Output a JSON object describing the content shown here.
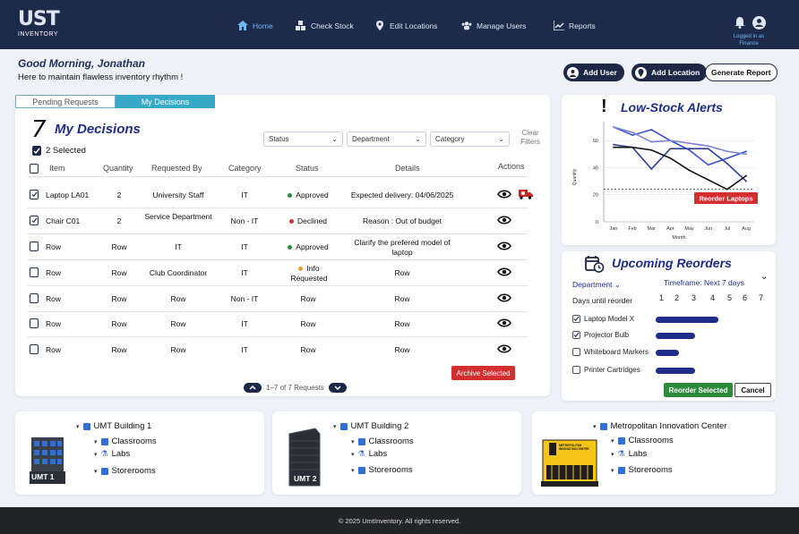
{
  "app": {
    "logo_mark": "UST",
    "logo_word": "INVENTORY"
  },
  "nav": {
    "items": [
      {
        "label": "Home",
        "icon": "home-icon",
        "active": true
      },
      {
        "label": "Check Stock",
        "icon": "boxes-icon"
      },
      {
        "label": "Edit Locations",
        "icon": "pin-icon"
      },
      {
        "label": "Manage Users",
        "icon": "users-icon"
      },
      {
        "label": "Reports",
        "icon": "chart-icon"
      }
    ],
    "logged_in_as": "Logged in as",
    "role": "Finance"
  },
  "header": {
    "greeting": "Good Morning, Jonathan",
    "subtitle": "Here to maintain flawless inventory rhythm !",
    "add_user": "Add User",
    "add_location": "Add Location",
    "generate_report": "Generate Report"
  },
  "decisions": {
    "tab_pending": "Pending Requests",
    "tab_mine": "My Decisions",
    "count": "7",
    "title": "My Decisions",
    "filters": {
      "status": "Status",
      "department": "Department",
      "category": "Category",
      "clear": "Clear Filters"
    },
    "selected_text": "2 Selected",
    "columns": [
      "Item",
      "Quantity",
      "Requested By",
      "Category",
      "Status",
      "Details",
      "Actions"
    ],
    "rows": [
      {
        "item": "Laptop LA01",
        "qty": "2",
        "by": "University Staff",
        "cat": "IT",
        "status": "Approved",
        "status_color": "#2e8b3a",
        "details": "Expected delivery: 04/06/2025",
        "checked": true,
        "truck": true
      },
      {
        "item": "Chair C01",
        "qty": "2",
        "by": "Service Department",
        "cat": "Non - IT",
        "status": "Declined",
        "status_color": "#d32f2f",
        "details": "Reason : Out of budget",
        "checked": true
      },
      {
        "item": "Row",
        "qty": "Row",
        "by": "IT",
        "cat": "IT",
        "status": "Approved",
        "status_color": "#2e8b3a",
        "details": "Clarify the prefered model of laptop"
      },
      {
        "item": "Row",
        "qty": "Row",
        "by": "Club Coordinator",
        "cat": "IT",
        "status": "Info Requested",
        "status_color": "#f0a030",
        "details": "Row"
      },
      {
        "item": "Row",
        "qty": "Row",
        "by": "Row",
        "cat": "Non - IT",
        "status": "Row",
        "details": "Row"
      },
      {
        "item": "Row",
        "qty": "Row",
        "by": "Row",
        "cat": "IT",
        "status": "Row",
        "details": "Row"
      },
      {
        "item": "Row",
        "qty": "Row",
        "by": "Row",
        "cat": "IT",
        "status": "Row",
        "details": "Row"
      }
    ],
    "archive": "Archive Selected",
    "pager": "1–7 of 7 Requests"
  },
  "low_stock": {
    "title": "Low-Stock Alerts",
    "ylabel": "Quantity",
    "xlabel": "Month",
    "reorder_label": "Reorder Laptops"
  },
  "chart_data": {
    "type": "line",
    "categories": [
      "Jan",
      "Feb",
      "Mar",
      "Apr",
      "May",
      "Jun",
      "Jul",
      "Aug"
    ],
    "ylim": [
      0,
      70
    ],
    "yticks": [
      0,
      20,
      40,
      60
    ],
    "threshold": 24,
    "series": [
      {
        "color": "#3a4fd0",
        "values": [
          70,
          64,
          68,
          60,
          53,
          42,
          47,
          52
        ]
      },
      {
        "color": "#7b86d6",
        "values": [
          70,
          66,
          59,
          60,
          58,
          56,
          52,
          50
        ]
      },
      {
        "color": "#2f3f9a",
        "values": [
          57,
          55,
          39,
          54,
          54,
          54,
          43,
          30
        ]
      },
      {
        "color": "#111111",
        "values": [
          55,
          55,
          53,
          47,
          38,
          31,
          24,
          34
        ]
      }
    ]
  },
  "upcoming": {
    "title": "Upcoming Reorders",
    "department": "Department",
    "timeframe": "Timeframe: Next 7 days",
    "days_label": "Days until reorder",
    "days": [
      "1",
      "2",
      "3",
      "4",
      "5",
      "6",
      "7"
    ],
    "items": [
      {
        "label": "Laptop Model X",
        "checked": true,
        "days": 4
      },
      {
        "label": "Projector Bulb",
        "checked": true,
        "days": 2.5
      },
      {
        "label": "Whiteboard Markers",
        "checked": false,
        "days": 1.5
      },
      {
        "label": "Printer Cartridges",
        "checked": false,
        "days": 2.5
      }
    ],
    "reorder": "Reorder Selected",
    "cancel": "Cancel"
  },
  "buildings": [
    {
      "name": "UMT Building 1",
      "badge": "UMT 1",
      "children": [
        "Classrooms",
        "Labs",
        "Storerooms"
      ]
    },
    {
      "name": "UMT Building 2",
      "badge": "UMT 2",
      "children": [
        "Classrooms",
        "Labs",
        "Storerooms"
      ]
    },
    {
      "name": "Metropolitan Innovation Center",
      "badge": "METROPOLITAN INNOVATION CENTER",
      "children": [
        "Classrooms",
        "Labs",
        "Storerooms"
      ]
    }
  ],
  "footer": "© 2025 UmtInventory. All rights reserved."
}
